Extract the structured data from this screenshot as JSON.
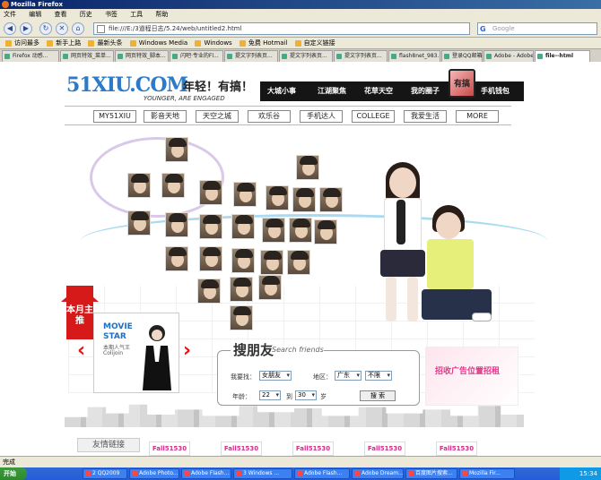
{
  "browser": {
    "title": "Mozilla Firefox",
    "menu": [
      "文件",
      "编辑",
      "查看",
      "历史",
      "书签",
      "工具",
      "帮助"
    ],
    "url": "file:///E:/3道程日志/5.24/web/untitled2.html",
    "search_placeholder": "Google",
    "bookmarks": [
      "访问最多",
      "新手上路",
      "最新头条",
      "Windows Media",
      "Windows",
      "免费 Hotmail",
      "自定义链接"
    ],
    "tabs": [
      "Firefox 动感...",
      "网页特效_菜单...",
      "网页特效_脚本...",
      "闪吧·专业的Fl...",
      "提文字列表页...",
      "提文字列表页...",
      "提文字列表页...",
      "flash8net_983...",
      "登录QQ邮箱",
      "Adobe - Adobe...",
      "file--html"
    ],
    "status": "完成"
  },
  "taskbar": {
    "start": "开始",
    "items": [
      "2 QQ2009",
      "Adobe Photo...",
      "Adobe Flash...",
      "3 Windows ...",
      "Adobe Flash...",
      "Adobe Dream...",
      "百度图片搜索...",
      "Mozilla Fir..."
    ],
    "clock": "15:34"
  },
  "site": {
    "logo": "51XIU.COM",
    "logo_prefix": "51",
    "logo_rest": "XIU.COM",
    "slogan": "年轻！有搞！",
    "sub": "YOUNGER, ARE ENGAGED",
    "top_nav": [
      "大城小事",
      "江湖聚焦",
      "花草天空",
      "我的圈子",
      "手机钱包"
    ],
    "cube_label": "有搞",
    "menu": [
      "MY51XIU",
      "影音天地",
      "天空之城",
      "欢乐谷",
      "手机达人",
      "COLLEGE",
      "我爱生活",
      "MORE"
    ],
    "redtag": "本月主推",
    "movie": {
      "line1": "MOVIE",
      "line2": "STAR",
      "line3": "本期人气王",
      "line4": "Colijoin"
    },
    "search": {
      "title": "搜朋友",
      "en": "Search friends",
      "find_label": "我要找：",
      "find_value": "女朋友",
      "area_label": "地区：",
      "area_value": "广东",
      "area2_value": "不限",
      "age_label": "年龄：",
      "age_from": "22",
      "age_to_label": "到",
      "age_to": "30",
      "age_unit": "岁",
      "button": "搜 索"
    },
    "ad_text": "招收广告位置招租",
    "friends_label": "友情链接",
    "friend_links": [
      "Fall51530",
      "Fall51530",
      "Fall51530",
      "Fall51530",
      "Fall51530"
    ]
  }
}
